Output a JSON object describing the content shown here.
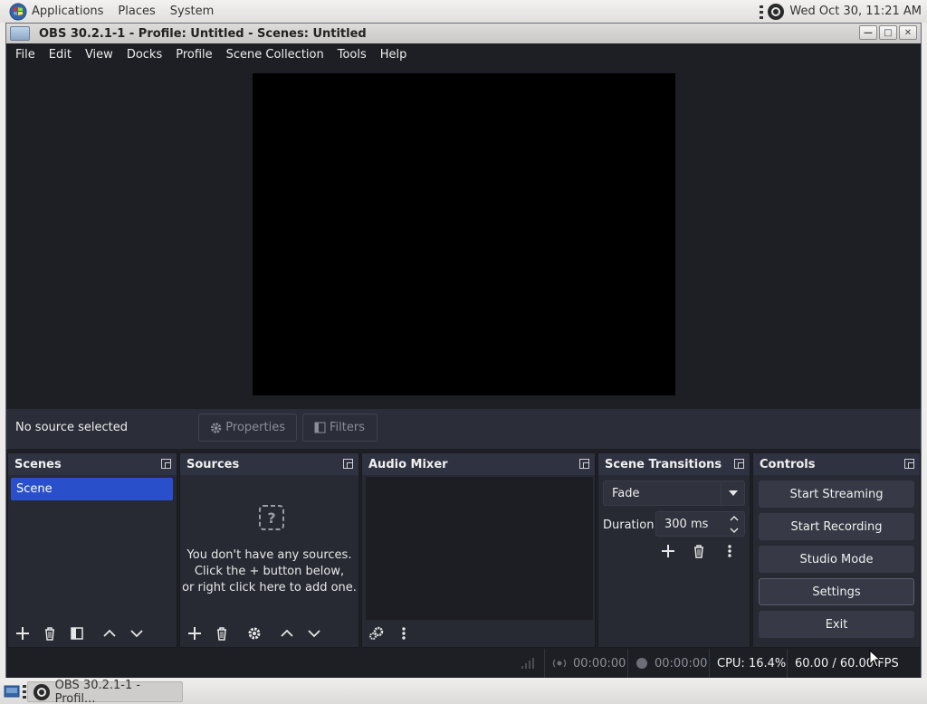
{
  "top_panel": {
    "menus": [
      "Applications",
      "Places",
      "System"
    ],
    "clock": "Wed Oct 30, 11:21 AM"
  },
  "window": {
    "title": "OBS 30.2.1-1 - Profile: Untitled - Scenes: Untitled",
    "controls": {
      "minimize": "—",
      "maximize": "□",
      "close": "✕"
    }
  },
  "menubar": [
    "File",
    "Edit",
    "View",
    "Docks",
    "Profile",
    "Scene Collection",
    "Tools",
    "Help"
  ],
  "source_toolbar": {
    "status": "No source selected",
    "properties": "Properties",
    "filters": "Filters"
  },
  "docks": {
    "scenes": {
      "title": "Scenes",
      "items": [
        "Scene"
      ]
    },
    "sources": {
      "title": "Sources",
      "empty_lines": [
        "You don't have any sources.",
        "Click the + button below,",
        "or right click here to add one."
      ]
    },
    "mixer": {
      "title": "Audio Mixer"
    },
    "transitions": {
      "title": "Scene Transitions",
      "selected": "Fade",
      "duration_label": "Duration",
      "duration_value": "300 ms"
    },
    "controls": {
      "title": "Controls",
      "buttons": [
        "Start Streaming",
        "Start Recording",
        "Studio Mode",
        "Settings",
        "Exit"
      ]
    }
  },
  "statusbar": {
    "stream_time": "00:00:00",
    "record_time": "00:00:00",
    "cpu": "CPU: 16.4%",
    "fps": "60.00 / 60.00 FPS"
  },
  "taskbar": {
    "window_label": "OBS 30.2.1-1 - Profil..."
  }
}
